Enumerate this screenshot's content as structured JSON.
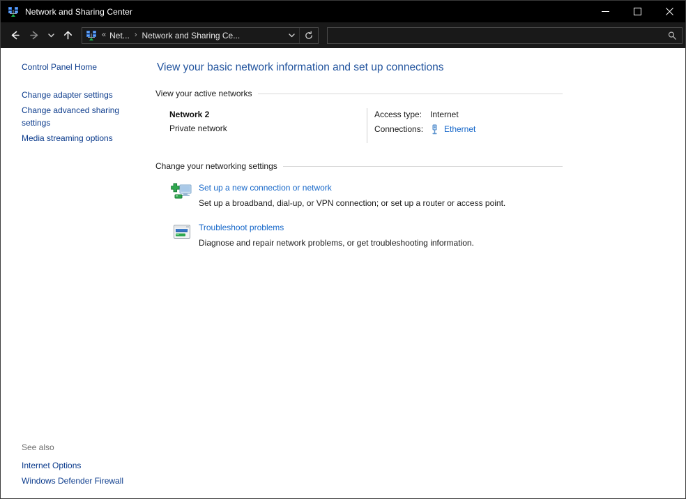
{
  "window": {
    "title": "Network and Sharing Center",
    "icon": "network-sharing-icon",
    "controls": {
      "minimize": "Minimize",
      "maximize": "Maximize",
      "close": "Close"
    }
  },
  "navbar": {
    "back": "Back",
    "forward": "Forward",
    "recent_locations": "Recent locations",
    "up": "Up",
    "breadcrumb": {
      "icon": "network-sharing-icon",
      "overflow": "«",
      "items": [
        {
          "label": "Net...",
          "separator": "›"
        },
        {
          "label": "Network and Sharing Ce...",
          "separator": ""
        }
      ],
      "dropdown": "Previous locations",
      "refresh": "Refresh"
    },
    "search": {
      "value": "",
      "placeholder": "",
      "icon": "search-icon"
    }
  },
  "sidebar": {
    "items": [
      {
        "label": "Control Panel Home"
      },
      {
        "label": "Change adapter settings"
      },
      {
        "label": "Change advanced sharing settings"
      },
      {
        "label": "Media streaming options"
      }
    ],
    "see_also": {
      "title": "See also",
      "items": [
        {
          "label": "Internet Options"
        },
        {
          "label": "Windows Defender Firewall"
        }
      ]
    }
  },
  "main": {
    "page_title": "View your basic network information and set up connections",
    "active_networks": {
      "header": "View your active networks",
      "network": {
        "name": "Network 2",
        "type": "Private network",
        "properties": [
          {
            "label": "Access type:",
            "value": "Internet",
            "is_link": false,
            "icon": ""
          },
          {
            "label": "Connections:",
            "value": "Ethernet",
            "is_link": true,
            "icon": "ethernet-icon"
          }
        ]
      }
    },
    "networking_settings": {
      "header": "Change your networking settings",
      "tasks": [
        {
          "icon": "new-connection-icon",
          "link": "Set up a new connection or network",
          "description": "Set up a broadband, dial-up, or VPN connection; or set up a router or access point."
        },
        {
          "icon": "troubleshoot-icon",
          "link": "Troubleshoot problems",
          "description": "Diagnose and repair network problems, or get troubleshooting information."
        }
      ]
    }
  },
  "colors": {
    "titlebar_bg": "#000000",
    "navbar_bg": "#191919",
    "page_title": "#22549e",
    "link": "#1667c9",
    "sidebar_link": "#0b3b8c",
    "rule": "#d8d8d8"
  }
}
